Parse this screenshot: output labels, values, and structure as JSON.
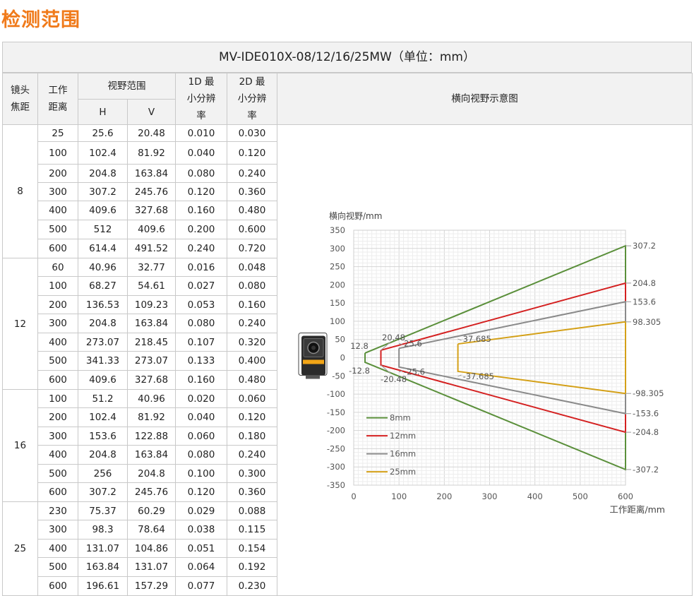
{
  "page": {
    "title": "检测范围"
  },
  "table": {
    "caption": "MV-IDE010X-08/12/16/25MW（单位：mm）",
    "headers": {
      "lens": "镜头焦距",
      "distance": "工作距离",
      "fov": "视野范围",
      "h": "H",
      "v": "V",
      "res1d": "1D 最小分辨率",
      "res2d": "2D 最小分辨率",
      "diagram": "横向视野示意图"
    },
    "groups": [
      {
        "lens": "8",
        "rows": [
          [
            "25",
            "25.6",
            "20.48",
            "0.010",
            "0.030"
          ],
          [
            "100",
            "102.4",
            "81.92",
            "0.040",
            "0.120"
          ],
          [
            "200",
            "204.8",
            "163.84",
            "0.080",
            "0.240"
          ],
          [
            "300",
            "307.2",
            "245.76",
            "0.120",
            "0.360"
          ],
          [
            "400",
            "409.6",
            "327.68",
            "0.160",
            "0.480"
          ],
          [
            "500",
            "512",
            "409.6",
            "0.200",
            "0.600"
          ],
          [
            "600",
            "614.4",
            "491.52",
            "0.240",
            "0.720"
          ]
        ]
      },
      {
        "lens": "12",
        "rows": [
          [
            "60",
            "40.96",
            "32.77",
            "0.016",
            "0.048"
          ],
          [
            "100",
            "68.27",
            "54.61",
            "0.027",
            "0.080"
          ],
          [
            "200",
            "136.53",
            "109.23",
            "0.053",
            "0.160"
          ],
          [
            "300",
            "204.8",
            "163.84",
            "0.080",
            "0.240"
          ],
          [
            "400",
            "273.07",
            "218.45",
            "0.107",
            "0.320"
          ],
          [
            "500",
            "341.33",
            "273.07",
            "0.133",
            "0.400"
          ],
          [
            "600",
            "409.6",
            "327.68",
            "0.160",
            "0.480"
          ]
        ]
      },
      {
        "lens": "16",
        "rows": [
          [
            "100",
            "51.2",
            "40.96",
            "0.020",
            "0.060"
          ],
          [
            "200",
            "102.4",
            "81.92",
            "0.040",
            "0.120"
          ],
          [
            "300",
            "153.6",
            "122.88",
            "0.060",
            "0.180"
          ],
          [
            "400",
            "204.8",
            "163.84",
            "0.080",
            "0.240"
          ],
          [
            "500",
            "256",
            "204.8",
            "0.100",
            "0.300"
          ],
          [
            "600",
            "307.2",
            "245.76",
            "0.120",
            "0.360"
          ]
        ]
      },
      {
        "lens": "25",
        "rows": [
          [
            "230",
            "75.37",
            "60.29",
            "0.029",
            "0.088"
          ],
          [
            "300",
            "98.3",
            "78.64",
            "0.038",
            "0.115"
          ],
          [
            "400",
            "131.07",
            "104.86",
            "0.051",
            "0.154"
          ],
          [
            "500",
            "163.84",
            "131.07",
            "0.064",
            "0.192"
          ],
          [
            "600",
            "196.61",
            "157.29",
            "0.077",
            "0.230"
          ]
        ]
      }
    ]
  },
  "chart_data": {
    "type": "line",
    "title": "",
    "xlabel": "工作距离/mm",
    "ylabel": "横向视野/mm",
    "xlim": [
      0,
      600
    ],
    "ylim": [
      -350,
      350
    ],
    "xticks": [
      "0",
      "100",
      "200",
      "300",
      "400",
      "500",
      "600"
    ],
    "yticks": [
      "350",
      "300",
      "250",
      "200",
      "150",
      "100",
      "50",
      "0",
      "-50",
      "-100",
      "-150",
      "-200",
      "-250",
      "-300",
      "-350"
    ],
    "grid": true,
    "legend_position": "bottom-left",
    "series": [
      {
        "name": "8mm",
        "color": "#5a8f3a",
        "points": [
          [
            25,
            12.8
          ],
          [
            600,
            307.2
          ],
          [
            600,
            -307.2
          ],
          [
            25,
            -12.8
          ],
          [
            25,
            12.8
          ]
        ],
        "labels": [
          {
            "x": 600,
            "y": 307.2,
            "text": "307.2",
            "side": "right"
          },
          {
            "x": 600,
            "y": -307.2,
            "text": "-307.2",
            "side": "right"
          },
          {
            "x": 25,
            "y": 12.8,
            "text": "12.8",
            "side": "left"
          },
          {
            "x": 25,
            "y": -12.8,
            "text": "-12.8",
            "side": "left"
          }
        ]
      },
      {
        "name": "12mm",
        "color": "#d42020",
        "points": [
          [
            60,
            20.48
          ],
          [
            600,
            204.8
          ],
          [
            600,
            -204.8
          ],
          [
            60,
            -20.48
          ],
          [
            60,
            20.48
          ]
        ],
        "labels": [
          {
            "x": 600,
            "y": 204.8,
            "text": "204.8",
            "side": "right"
          },
          {
            "x": 600,
            "y": -204.8,
            "text": "-204.8",
            "side": "right"
          },
          {
            "x": 60,
            "y": 20.48,
            "text": "20.48",
            "side": "up"
          },
          {
            "x": 60,
            "y": -20.48,
            "text": "-20.48",
            "side": "down"
          }
        ]
      },
      {
        "name": "16mm",
        "color": "#8a8a8a",
        "points": [
          [
            100,
            25.6
          ],
          [
            600,
            153.6
          ],
          [
            600,
            -153.6
          ],
          [
            100,
            -25.6
          ],
          [
            100,
            25.6
          ]
        ],
        "labels": [
          {
            "x": 600,
            "y": 153.6,
            "text": "153.6",
            "side": "right"
          },
          {
            "x": 600,
            "y": -153.6,
            "text": "-153.6",
            "side": "right"
          },
          {
            "x": 100,
            "y": 25.6,
            "text": "25.6",
            "side": "inner"
          },
          {
            "x": 100,
            "y": -25.6,
            "text": "-25.6",
            "side": "inner"
          }
        ]
      },
      {
        "name": "25mm",
        "color": "#d4a017",
        "points": [
          [
            230,
            37.685
          ],
          [
            600,
            98.305
          ],
          [
            600,
            -98.305
          ],
          [
            230,
            -37.685
          ],
          [
            230,
            37.685
          ]
        ],
        "labels": [
          {
            "x": 600,
            "y": 98.305,
            "text": "98.305",
            "side": "right"
          },
          {
            "x": 600,
            "y": -98.305,
            "text": "-98.305",
            "side": "right"
          },
          {
            "x": 230,
            "y": 37.685,
            "text": "37.685",
            "side": "inner"
          },
          {
            "x": 230,
            "y": -37.685,
            "text": "-37.685",
            "side": "inner"
          }
        ]
      }
    ]
  },
  "icons": {
    "camera": "camera-device-icon"
  }
}
